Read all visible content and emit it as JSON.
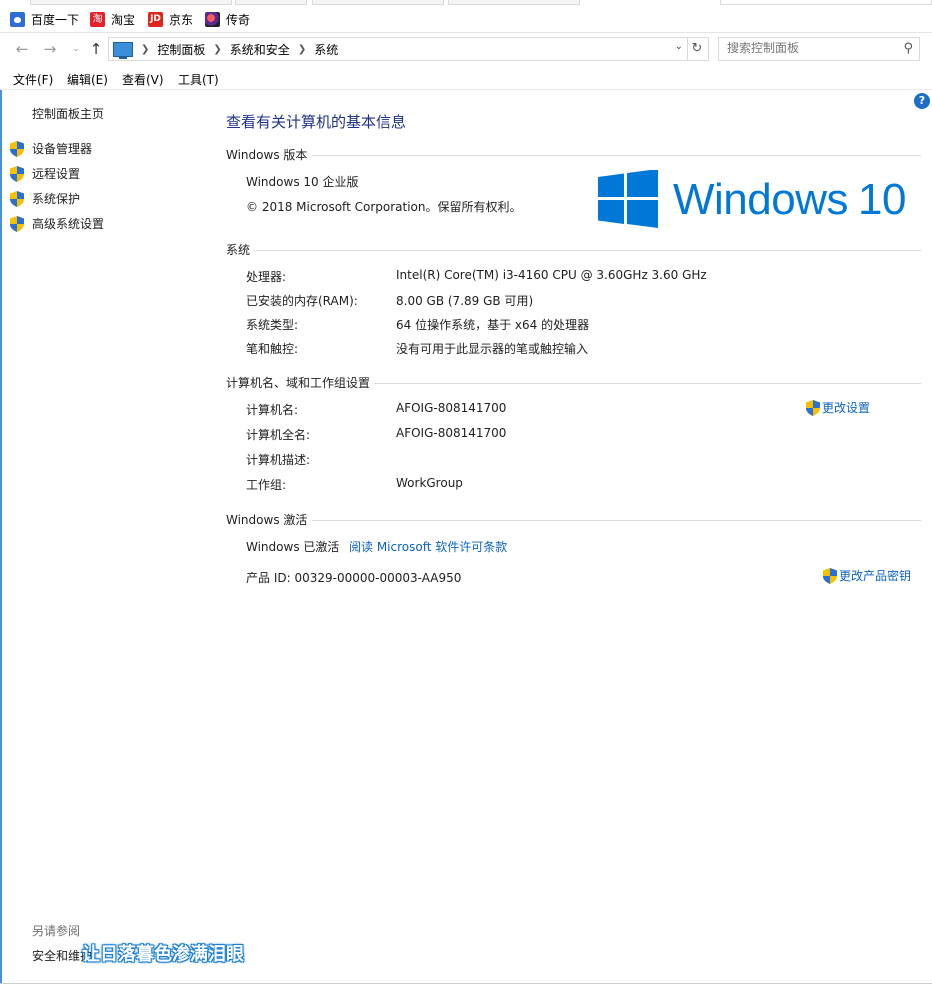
{
  "bookmarks": [
    {
      "label": "百度一下",
      "icon": "baidu-paw-icon"
    },
    {
      "label": "淘宝",
      "icon": "taobao-icon",
      "glyph": "淘"
    },
    {
      "label": "京东",
      "icon": "jd-icon",
      "glyph": "JD"
    },
    {
      "label": "传奇",
      "icon": "chuanqi-icon"
    }
  ],
  "address": {
    "breadcrumbs": [
      "控制面板",
      "系统和安全",
      "系统"
    ],
    "search_placeholder": "搜索控制面板"
  },
  "menu": [
    "文件(F)",
    "编辑(E)",
    "查看(V)",
    "工具(T)"
  ],
  "left_pane": {
    "home": "控制面板主页",
    "links": [
      "设备管理器",
      "远程设置",
      "系统保护",
      "高级系统设置"
    ],
    "see_also_title": "另请参阅",
    "see_also_item": "安全和维护"
  },
  "main": {
    "title": "查看有关计算机的基本信息",
    "edition_section": "Windows 版本",
    "edition": "Windows 10 企业版",
    "copyright": "© 2018 Microsoft Corporation。保留所有权利。",
    "logo_text": "Windows",
    "logo_num": "10",
    "system_section": "系统",
    "system_rows": [
      {
        "label": "处理器:",
        "value": "Intel(R) Core(TM) i3-4160 CPU @ 3.60GHz   3.60 GHz"
      },
      {
        "label": "已安装的内存(RAM):",
        "value": "8.00 GB (7.89 GB 可用)"
      },
      {
        "label": "系统类型:",
        "value": "64 位操作系统，基于 x64 的处理器"
      },
      {
        "label": "笔和触控:",
        "value": "没有可用于此显示器的笔或触控输入"
      }
    ],
    "computer_section": "计算机名、域和工作组设置",
    "computer_rows": [
      {
        "label": "计算机名:",
        "value": "AFOIG-808141700"
      },
      {
        "label": "计算机全名:",
        "value": "AFOIG-808141700"
      },
      {
        "label": "计算机描述:",
        "value": ""
      },
      {
        "label": "工作组:",
        "value": "WorkGroup"
      }
    ],
    "change_settings": "更改设置",
    "activation_section": "Windows 激活",
    "activated": "Windows 已激活",
    "license_link": "阅读 Microsoft 软件许可条款",
    "product_id": "产品 ID: 00329-00000-00003-AA950",
    "change_key": "更改产品密钥"
  },
  "overlay_subtitle": "让日落暮色渗满泪眼",
  "colors": {
    "accent": "#0078d7",
    "link": "#0b63c1",
    "title": "#1e3287"
  }
}
